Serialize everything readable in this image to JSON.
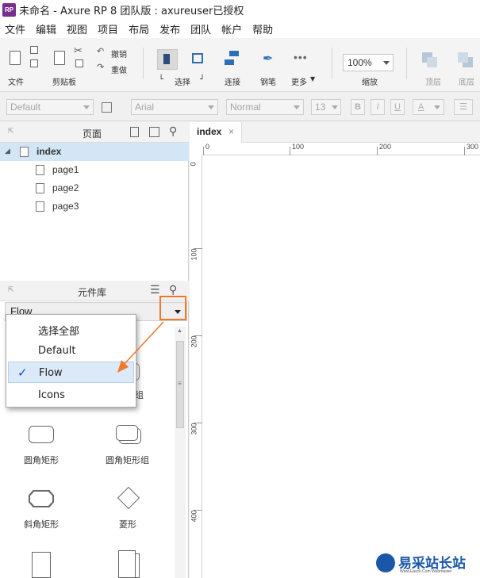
{
  "window": {
    "title": "未命名 - Axure RP 8 团队版 : axureuser已授权",
    "logo_text": "RP"
  },
  "menu": [
    "文件",
    "编辑",
    "视图",
    "项目",
    "布局",
    "发布",
    "团队",
    "帐户",
    "帮助"
  ],
  "toolbar": {
    "file_label": "文件",
    "clipboard_label": "剪贴板",
    "undo_label": "撤销",
    "redo_label": "重做",
    "select_label": "选择",
    "connect_label": "连接",
    "pen_label": "钢笔",
    "more_label": "更多",
    "zoom_value": "100%",
    "zoom_label": "缩放",
    "top_label": "顶层",
    "bottom_label": "底层"
  },
  "format": {
    "style_value": "Default",
    "font_value": "Arial",
    "weight_value": "Normal",
    "size_value": "13",
    "bold": "B",
    "italic": "I",
    "underline": "U",
    "font_color": "A"
  },
  "pages_panel": {
    "title": "页面",
    "items": [
      {
        "label": "index",
        "level": 0
      },
      {
        "label": "page1",
        "level": 1
      },
      {
        "label": "page2",
        "level": 1
      },
      {
        "label": "page3",
        "level": 1
      }
    ]
  },
  "library_panel": {
    "title": "元件库",
    "selected": "Flow",
    "options": [
      "选择全部",
      "Default",
      "Flow",
      "Icons"
    ],
    "widgets": [
      "圆角矩形",
      "圆角矩形组",
      "斜角矩形",
      "菱形"
    ],
    "partial_label": "组"
  },
  "canvas": {
    "tab_label": "index",
    "tab_close": "×",
    "hruler_labels": [
      "0",
      "100",
      "200",
      "300"
    ],
    "vruler_labels": [
      "0",
      "100",
      "200",
      "300",
      "400"
    ]
  },
  "watermark": {
    "text": "易采站长站",
    "sub": "Www.Easck.Com Webmaster"
  },
  "colors": {
    "highlight": "#dbe9f9",
    "annotation": "#f07a2b",
    "logo": "#7a2d8c"
  }
}
